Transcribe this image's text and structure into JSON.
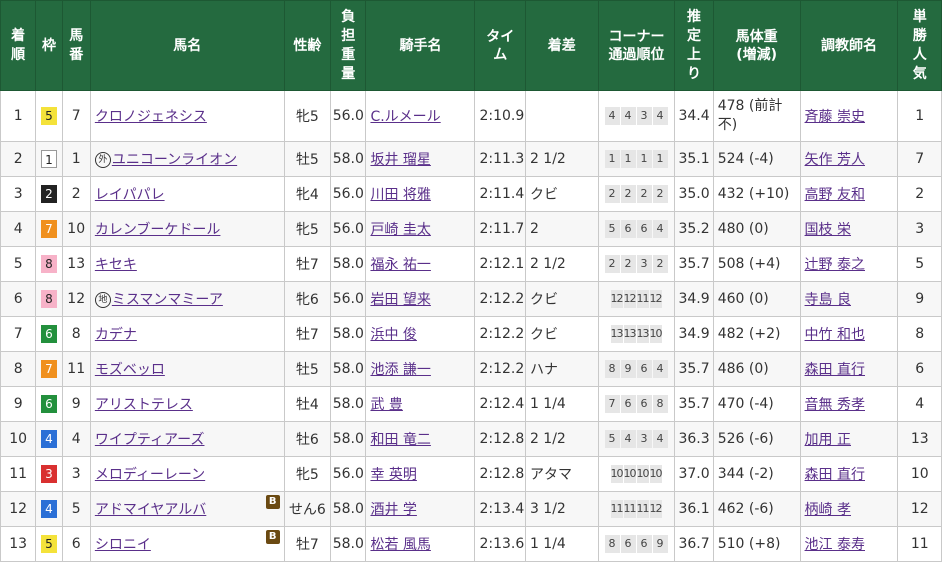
{
  "headers": {
    "rank": "着順",
    "frame": "枠",
    "number": "馬番",
    "horse": "馬名",
    "sex_age": "性齢",
    "weight": "負担重量",
    "jockey": "騎手名",
    "time": "タイム",
    "margin": "着差",
    "corner_line1": "コーナー",
    "corner_line2": "通過順位",
    "last3f": "推定上り",
    "body_line1": "馬体重",
    "body_line2": "(増減)",
    "trainer": "調教師名",
    "popularity": "単勝人気"
  },
  "colors": {
    "header_bg": "#246a3f",
    "link": "#5a2f8a",
    "frame_1": "#ffffff",
    "frame_2": "#222222",
    "frame_3": "#d93030",
    "frame_4": "#2b6fd6",
    "frame_5": "#f4e23a",
    "frame_6": "#23903d",
    "frame_7": "#f0901e",
    "frame_8": "#f7b2c8"
  },
  "rows": [
    {
      "rank": "1",
      "frame": "5",
      "num": "7",
      "mark": "",
      "horse": "クロノジェネシス",
      "badge": "",
      "sex_age": "牝5",
      "weight": "56.0",
      "jockey": "C.ルメール",
      "time": "2:10.9",
      "margin": "",
      "corners": [
        "4",
        "4",
        "3",
        "4"
      ],
      "last3f": "34.4",
      "body": "478 (前計不)",
      "trainer": "斉藤 崇史",
      "pop": "1"
    },
    {
      "rank": "2",
      "frame": "1",
      "num": "1",
      "mark": "外",
      "horse": "ユニコーンライオン",
      "badge": "",
      "sex_age": "牡5",
      "weight": "58.0",
      "jockey": "坂井 瑠星",
      "time": "2:11.3",
      "margin": "2 1/2",
      "corners": [
        "1",
        "1",
        "1",
        "1"
      ],
      "last3f": "35.1",
      "body": "524 (-4)",
      "trainer": "矢作 芳人",
      "pop": "7"
    },
    {
      "rank": "3",
      "frame": "2",
      "num": "2",
      "mark": "",
      "horse": "レイパパレ",
      "badge": "",
      "sex_age": "牝4",
      "weight": "56.0",
      "jockey": "川田 将雅",
      "time": "2:11.4",
      "margin": "クビ",
      "corners": [
        "2",
        "2",
        "2",
        "2"
      ],
      "last3f": "35.0",
      "body": "432 (+10)",
      "trainer": "高野 友和",
      "pop": "2"
    },
    {
      "rank": "4",
      "frame": "7",
      "num": "10",
      "mark": "",
      "horse": "カレンブーケドール",
      "badge": "",
      "sex_age": "牝5",
      "weight": "56.0",
      "jockey": "戸崎 圭太",
      "time": "2:11.7",
      "margin": "2",
      "corners": [
        "5",
        "6",
        "6",
        "4"
      ],
      "last3f": "35.2",
      "body": "480 (0)",
      "trainer": "国枝 栄",
      "pop": "3"
    },
    {
      "rank": "5",
      "frame": "8",
      "num": "13",
      "mark": "",
      "horse": "キセキ",
      "badge": "",
      "sex_age": "牡7",
      "weight": "58.0",
      "jockey": "福永 祐一",
      "time": "2:12.1",
      "margin": "2 1/2",
      "corners": [
        "2",
        "2",
        "3",
        "2"
      ],
      "last3f": "35.7",
      "body": "508 (+4)",
      "trainer": "辻野 泰之",
      "pop": "5"
    },
    {
      "rank": "6",
      "frame": "8",
      "num": "12",
      "mark": "地",
      "horse": "ミスマンマミーア",
      "badge": "",
      "sex_age": "牝6",
      "weight": "56.0",
      "jockey": "岩田 望来",
      "time": "2:12.2",
      "margin": "クビ",
      "corners": [
        "12",
        "12",
        "11",
        "12"
      ],
      "last3f": "34.9",
      "body": "460 (0)",
      "trainer": "寺島 良",
      "pop": "9"
    },
    {
      "rank": "7",
      "frame": "6",
      "num": "8",
      "mark": "",
      "horse": "カデナ",
      "badge": "",
      "sex_age": "牡7",
      "weight": "58.0",
      "jockey": "浜中 俊",
      "time": "2:12.2",
      "margin": "クビ",
      "corners": [
        "13",
        "13",
        "13",
        "10"
      ],
      "last3f": "34.9",
      "body": "482 (+2)",
      "trainer": "中竹 和也",
      "pop": "8"
    },
    {
      "rank": "8",
      "frame": "7",
      "num": "11",
      "mark": "",
      "horse": "モズベッロ",
      "badge": "",
      "sex_age": "牡5",
      "weight": "58.0",
      "jockey": "池添 謙一",
      "time": "2:12.2",
      "margin": "ハナ",
      "corners": [
        "8",
        "9",
        "6",
        "4"
      ],
      "last3f": "35.7",
      "body": "486 (0)",
      "trainer": "森田 直行",
      "pop": "6"
    },
    {
      "rank": "9",
      "frame": "6",
      "num": "9",
      "mark": "",
      "horse": "アリストテレス",
      "badge": "",
      "sex_age": "牡4",
      "weight": "58.0",
      "jockey": "武 豊",
      "time": "2:12.4",
      "margin": "1 1/4",
      "corners": [
        "7",
        "6",
        "6",
        "8"
      ],
      "last3f": "35.7",
      "body": "470 (-4)",
      "trainer": "音無 秀孝",
      "pop": "4"
    },
    {
      "rank": "10",
      "frame": "4",
      "num": "4",
      "mark": "",
      "horse": "ワイプティアーズ",
      "badge": "",
      "sex_age": "牡6",
      "weight": "58.0",
      "jockey": "和田 竜二",
      "time": "2:12.8",
      "margin": "2 1/2",
      "corners": [
        "5",
        "4",
        "3",
        "4"
      ],
      "last3f": "36.3",
      "body": "526 (-6)",
      "trainer": "加用 正",
      "pop": "13"
    },
    {
      "rank": "11",
      "frame": "3",
      "num": "3",
      "mark": "",
      "horse": "メロディーレーン",
      "badge": "",
      "sex_age": "牝5",
      "weight": "56.0",
      "jockey": "幸 英明",
      "time": "2:12.8",
      "margin": "アタマ",
      "corners": [
        "10",
        "10",
        "10",
        "10"
      ],
      "last3f": "37.0",
      "body": "344 (-2)",
      "trainer": "森田 直行",
      "pop": "10"
    },
    {
      "rank": "12",
      "frame": "4",
      "num": "5",
      "mark": "",
      "horse": "アドマイヤアルバ",
      "badge": "B",
      "sex_age": "せん6",
      "weight": "58.0",
      "jockey": "酒井 学",
      "time": "2:13.4",
      "margin": "3 1/2",
      "corners": [
        "11",
        "11",
        "11",
        "12"
      ],
      "last3f": "36.1",
      "body": "462 (-6)",
      "trainer": "柄崎 孝",
      "pop": "12"
    },
    {
      "rank": "13",
      "frame": "5",
      "num": "6",
      "mark": "",
      "horse": "シロニイ",
      "badge": "B",
      "sex_age": "牡7",
      "weight": "58.0",
      "jockey": "松若 風馬",
      "time": "2:13.6",
      "margin": "1 1/4",
      "corners": [
        "8",
        "6",
        "6",
        "9"
      ],
      "last3f": "36.7",
      "body": "510 (+8)",
      "trainer": "池江 泰寿",
      "pop": "11"
    }
  ]
}
